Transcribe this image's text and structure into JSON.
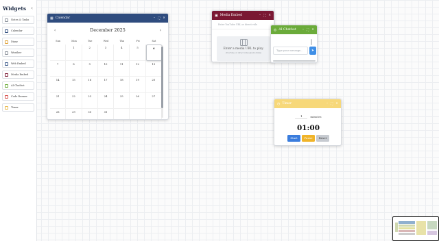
{
  "sidebar": {
    "title": "Widgets",
    "collapse_icon": "chevron-left-icon",
    "items": [
      {
        "label": "Notes & Tasks",
        "icon": "notes-icon",
        "color": "#8a9099"
      },
      {
        "label": "Calendar",
        "icon": "calendar-icon",
        "color": "#2f4c7e"
      },
      {
        "label": "Diary",
        "icon": "diary-icon",
        "color": "#e0a33a"
      },
      {
        "label": "Weather",
        "icon": "weather-icon",
        "color": "#8a9099"
      },
      {
        "label": "Web Embed",
        "icon": "globe-icon",
        "color": "#3c5a8a"
      },
      {
        "label": "Media Embed",
        "icon": "film-icon",
        "color": "#7a1833"
      },
      {
        "label": "AI Chatbot",
        "icon": "chat-icon",
        "color": "#6bab3a"
      },
      {
        "label": "Code Runner",
        "icon": "code-icon",
        "color": "#d9534f"
      },
      {
        "label": "Timer",
        "icon": "timer-icon",
        "color": "#e8b84a"
      }
    ]
  },
  "calendar": {
    "title": "Calendar",
    "accent": "#2f4c7e",
    "month": "December 2025",
    "prev_icon": "chevron-left-icon",
    "next_icon": "chevron-right-icon",
    "weekdays": [
      "Sun",
      "Mon",
      "Tue",
      "Wed",
      "Thu",
      "Fri",
      "Sat"
    ],
    "weeks": [
      [
        "",
        "1",
        "2",
        "3",
        "4",
        "5",
        "6"
      ],
      [
        "7",
        "8",
        "9",
        "10",
        "11",
        "12",
        "13"
      ],
      [
        "14",
        "15",
        "16",
        "17",
        "18",
        "19",
        "20"
      ],
      [
        "21",
        "22",
        "23",
        "24",
        "25",
        "26",
        "27"
      ],
      [
        "28",
        "29",
        "30",
        "31",
        "",
        "",
        ""
      ]
    ],
    "today": "6"
  },
  "media": {
    "title": "Media Embed",
    "accent": "#7a1833",
    "input_placeholder": "Enter YouTube URL or direct vide",
    "drop_title": "Enter a media URL to play.",
    "drop_sub": "(YouTube or direct video/audio links)"
  },
  "chat": {
    "title": "AI Chatbot",
    "accent": "#6bab3a",
    "input_placeholder": "Type your message...",
    "send_icon": "send-icon"
  },
  "timer": {
    "title": "Timer",
    "accent": "#f7d879",
    "minutes_value": "1",
    "minutes_label": "minutes",
    "display": "01:00",
    "start_label": "Start",
    "pause_label": "Pause",
    "reset_label": "Reset",
    "start_color": "#3b7ddd",
    "pause_color": "#f0b429",
    "reset_color": "#c7cbd1"
  }
}
